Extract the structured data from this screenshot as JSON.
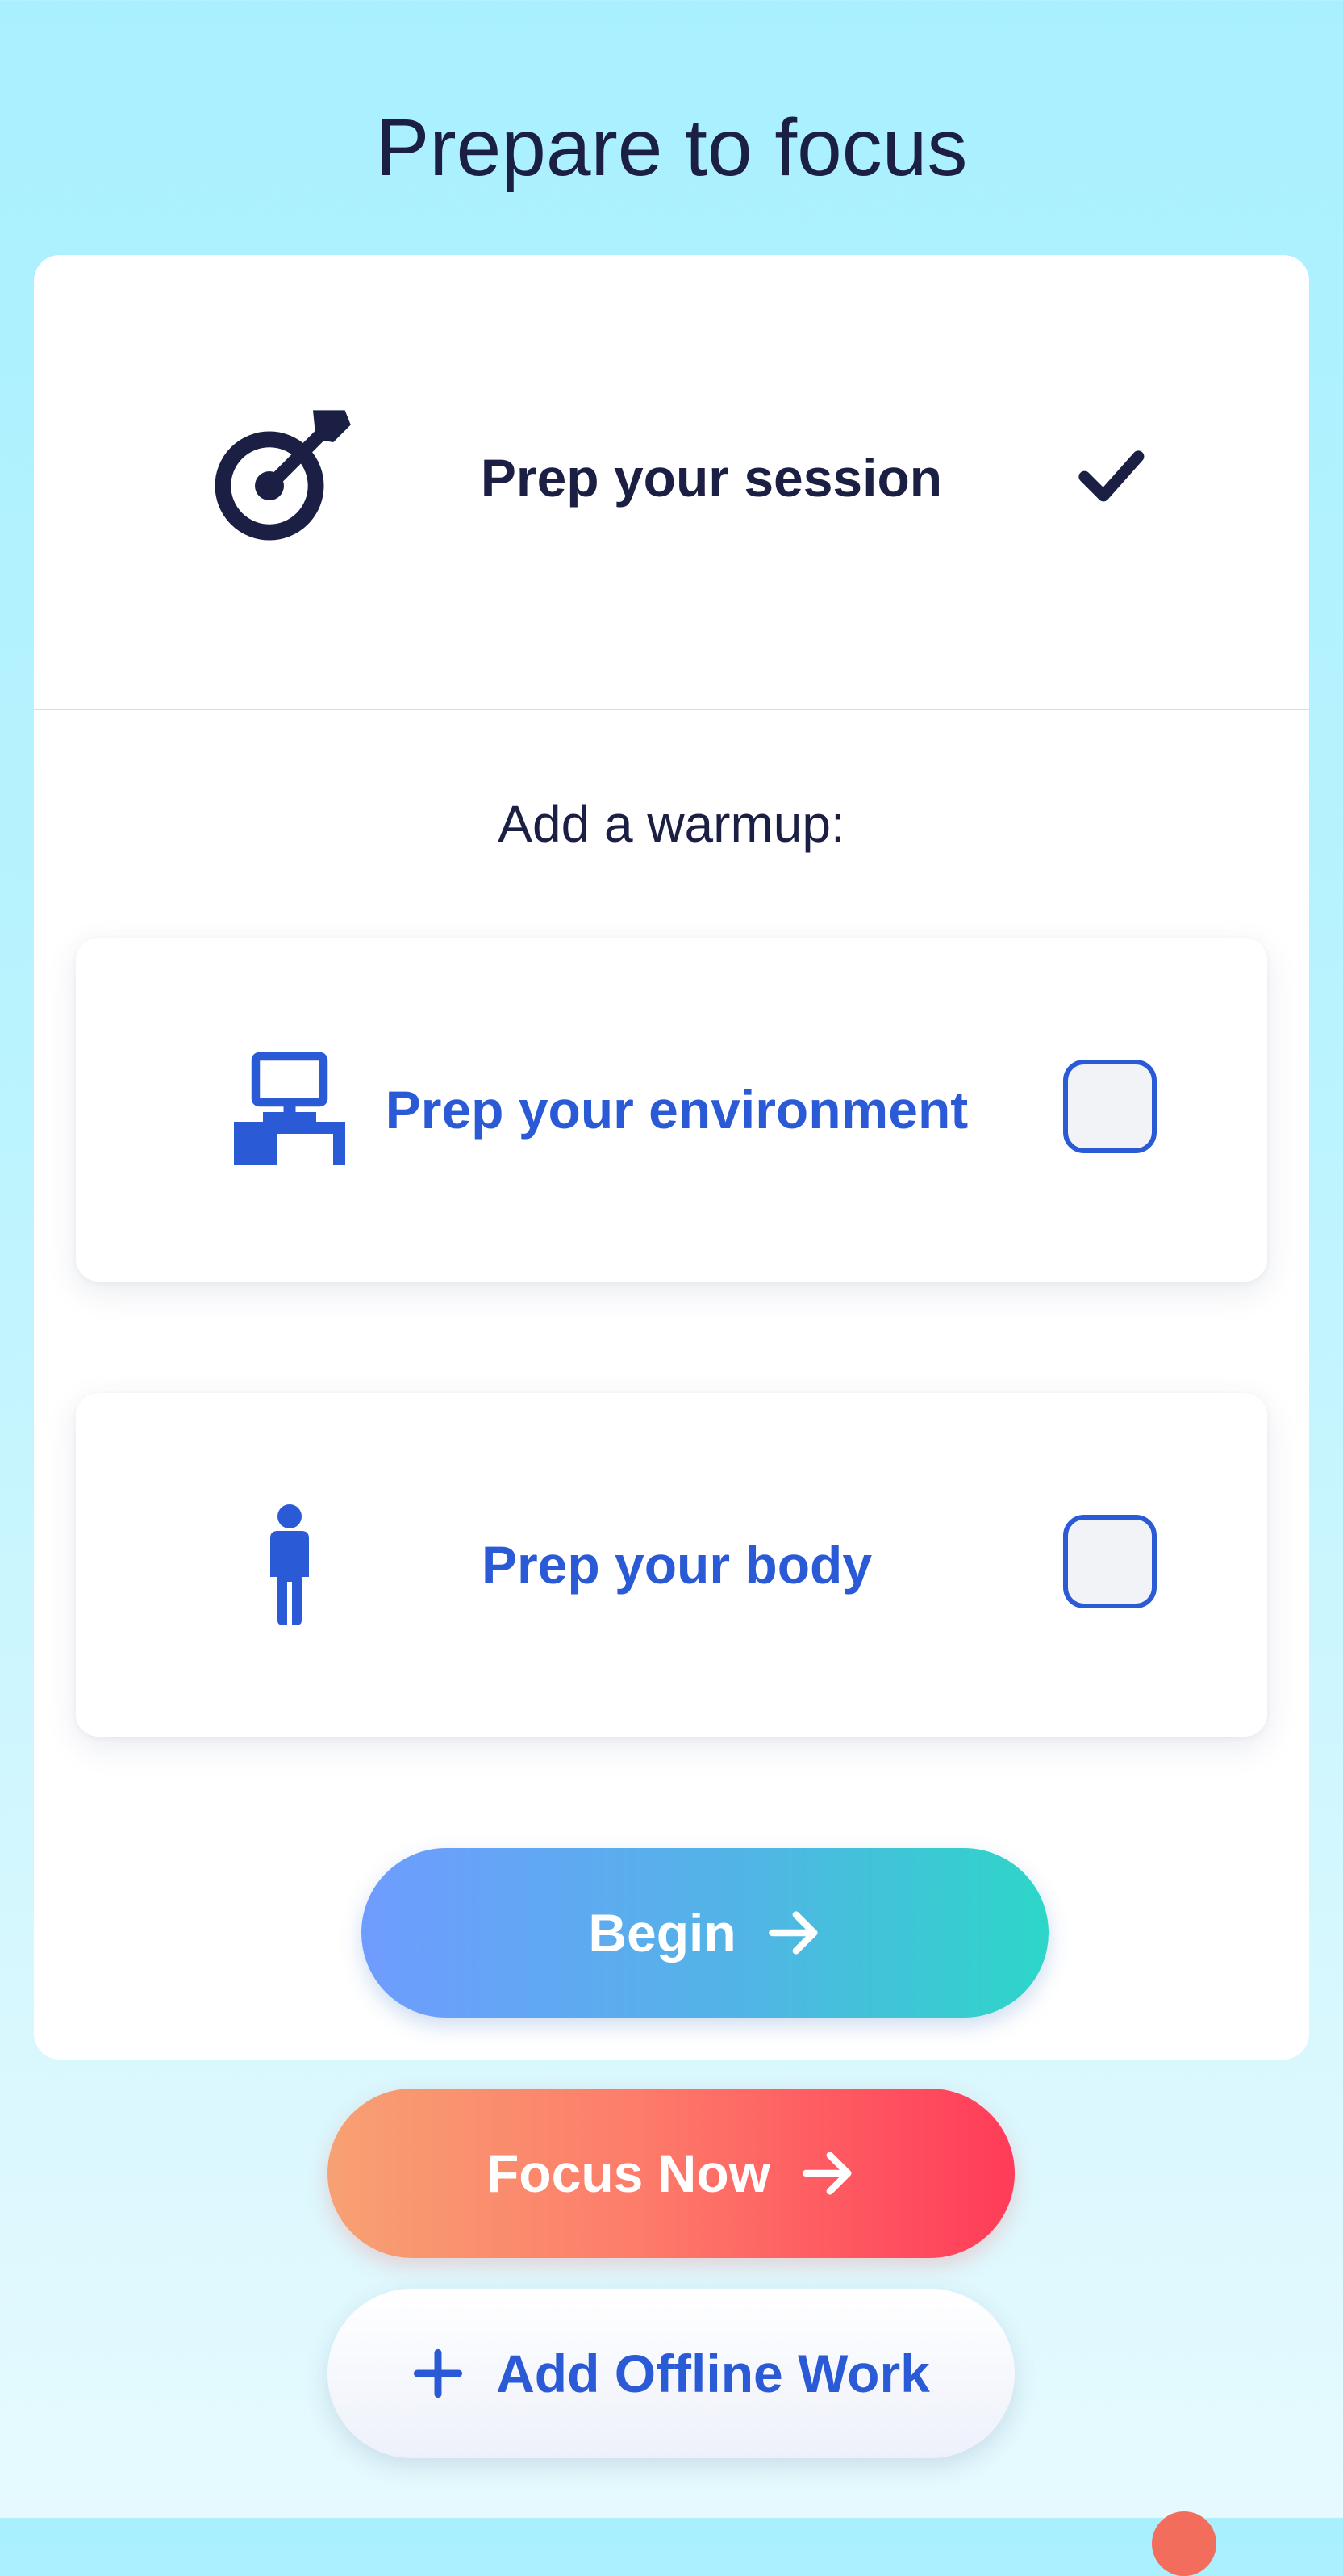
{
  "page": {
    "title": "Prepare to focus"
  },
  "session": {
    "label": "Prep your session",
    "icon": "target-arrow-icon",
    "status_icon": "checkmark-icon",
    "completed": true
  },
  "warmup": {
    "heading": "Add a warmup:",
    "options": [
      {
        "label": "Prep your environment",
        "icon": "desk-computer-icon",
        "checked": false
      },
      {
        "label": "Prep your body",
        "icon": "person-icon",
        "checked": false
      }
    ]
  },
  "actions": {
    "begin_label": "Begin",
    "focus_now_label": "Focus Now",
    "add_offline_label": "Add Offline Work"
  },
  "colors": {
    "text_dark": "#1b1f44",
    "accent_blue": "#2a5ad6",
    "begin_gradient": [
      "#6f9cff",
      "#2dd6c8"
    ],
    "focus_gradient": [
      "#f7a173",
      "#ff3b59"
    ],
    "background": "#a9f0fe"
  }
}
